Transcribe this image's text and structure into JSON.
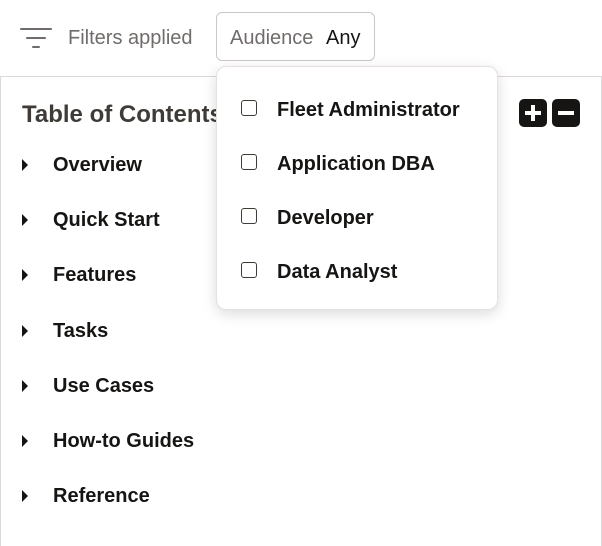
{
  "filter_bar": {
    "icon": "filter-lines-icon",
    "label": "Filters applied",
    "audience": {
      "label": "Audience",
      "value": "Any"
    }
  },
  "toc": {
    "title": "Table of Contents",
    "expand_icon": "plus-square-icon",
    "collapse_icon": "minus-square-icon",
    "items": [
      {
        "label": "Overview"
      },
      {
        "label": "Quick Start"
      },
      {
        "label": "Features"
      },
      {
        "label": "Tasks"
      },
      {
        "label": "Use Cases"
      },
      {
        "label": "How-to Guides"
      },
      {
        "label": "Reference"
      }
    ]
  },
  "audience_dropdown": {
    "options": [
      {
        "label": "Fleet Administrator",
        "checked": false
      },
      {
        "label": "Application DBA",
        "checked": false
      },
      {
        "label": "Developer",
        "checked": false
      },
      {
        "label": "Data Analyst",
        "checked": false
      }
    ]
  }
}
